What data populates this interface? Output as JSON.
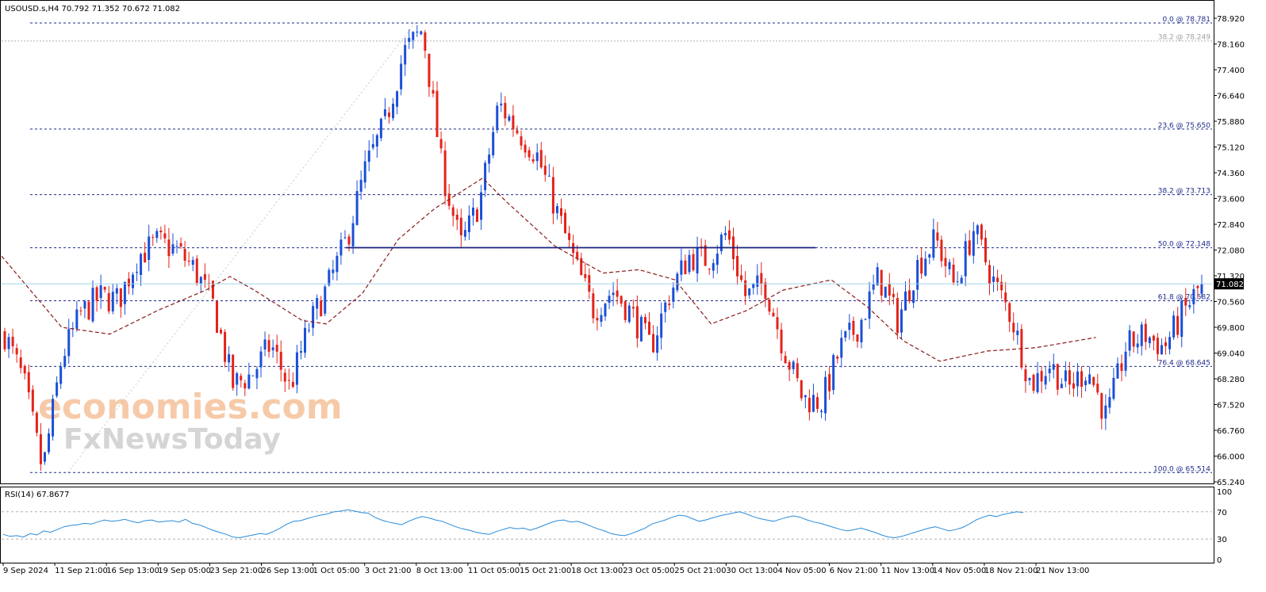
{
  "header": {
    "symbol_info": "USOUSD.s,H4  70.792 71.352 70.672 71.082",
    "rsi_label": "RSI(14) 67.8677"
  },
  "watermark": {
    "line1": "economies.com",
    "line2": "FxNewsToday"
  },
  "colors": {
    "bull": "#1b4fd6",
    "bear": "#e2231a",
    "ma": "#8b1a1a",
    "fib": "#1e2a8a",
    "resistance": "#1a237e",
    "rsi": "#2a8bd8",
    "current_price_line": "#9fd3e6",
    "price_tag_bg": "#000000"
  },
  "chart_data": [
    {
      "type": "candlestick",
      "symbol": "USOUSD.s",
      "timeframe": "H4",
      "ylim": [
        65.24,
        78.92
      ],
      "y_ticks": [
        "78.920",
        "78.160",
        "77.400",
        "76.640",
        "75.880",
        "75.120",
        "74.360",
        "73.600",
        "72.840",
        "72.080",
        "71.320",
        "70.560",
        "69.800",
        "69.040",
        "68.280",
        "67.520",
        "66.760",
        "66.000",
        "65.240"
      ],
      "x_ticks": [
        "9 Sep 2024",
        "11 Sep 21:00",
        "16 Sep 13:00",
        "19 Sep 05:00",
        "23 Sep 21:00",
        "26 Sep 13:00",
        "1 Oct 05:00",
        "3 Oct 21:00",
        "8 Oct 13:00",
        "11 Oct 05:00",
        "15 Oct 21:00",
        "18 Oct 13:00",
        "23 Oct 05:00",
        "25 Oct 21:00",
        "30 Oct 13:00",
        "4 Nov 05:00",
        "6 Nov 21:00",
        "11 Nov 13:00",
        "14 Nov 05:00",
        "18 Nov 21:00",
        "21 Nov 13:00"
      ],
      "current_price": "71.082",
      "last_ohlc": {
        "open": 70.792,
        "high": 71.352,
        "low": 70.672,
        "close": 71.082
      },
      "fib_levels": [
        {
          "label": "0.0 @ 78.781",
          "value": 78.781,
          "style": "dashed"
        },
        {
          "label": "38.2 @ 78.249",
          "value": 78.249,
          "style": "dotted"
        },
        {
          "label": "23.6 @ 75.650",
          "value": 75.65,
          "style": "dashed"
        },
        {
          "label": "38.2 @ 73.713",
          "value": 73.713,
          "style": "dashed"
        },
        {
          "label": "50.0 @ 72.148",
          "value": 72.148,
          "style": "dashed"
        },
        {
          "label": "61.8 @ 70.582",
          "value": 70.582,
          "style": "dashed"
        },
        {
          "label": "76.4 @ 68.645",
          "value": 68.645,
          "style": "dashed"
        },
        {
          "label": "100.0 @ 65.514",
          "value": 65.514,
          "style": "dashed"
        }
      ],
      "resistance_line": {
        "value": 72.15,
        "from_label": "3 Oct 21:00",
        "to_label": "6 Nov 21:00"
      },
      "anchors": [
        [
          "9 Sep 2024",
          69.6
        ],
        [
          "10 Sep",
          68.2
        ],
        [
          "10 Sep",
          65.55
        ],
        [
          "11 Sep 21:00",
          68.9
        ],
        [
          "13 Sep",
          70.2
        ],
        [
          "16 Sep 13:00",
          70.7
        ],
        [
          "18 Sep",
          70.6
        ],
        [
          "19 Sep 05:00",
          71.9
        ],
        [
          "20 Sep",
          72.3
        ],
        [
          "23 Sep 21:00",
          72.1
        ],
        [
          "24 Sep",
          71.5
        ],
        [
          "25 Sep",
          70.4
        ],
        [
          "26 Sep 13:00",
          68.1
        ],
        [
          "27 Sep",
          68.4
        ],
        [
          "30 Sep",
          69.3
        ],
        [
          "1 Oct 05:00",
          68.0
        ],
        [
          "1 Oct",
          69.8
        ],
        [
          "2 Oct",
          71.0
        ],
        [
          "3 Oct 21:00",
          72.4
        ],
        [
          "4 Oct",
          74.5
        ],
        [
          "5 Oct",
          75.8
        ],
        [
          "7 Oct",
          77.9
        ],
        [
          "7 Oct",
          78.6
        ],
        [
          "8 Oct",
          74.5
        ],
        [
          "8 Oct 13:00",
          72.2
        ],
        [
          "9 Oct",
          73.5
        ],
        [
          "10 Oct",
          76.4
        ],
        [
          "11 Oct 05:00",
          75.6
        ],
        [
          "11 Oct",
          74.9
        ],
        [
          "14 Oct",
          73.3
        ],
        [
          "14 Oct",
          71.7
        ],
        [
          "15 Oct 21:00",
          70.3
        ],
        [
          "16 Oct",
          70.9
        ],
        [
          "17 Oct",
          70.2
        ],
        [
          "18 Oct 13:00",
          69.2
        ],
        [
          "21 Oct",
          70.8
        ],
        [
          "22 Oct",
          71.9
        ],
        [
          "23 Oct 05:00",
          71.8
        ],
        [
          "23 Oct",
          72.6
        ],
        [
          "24 Oct",
          70.7
        ],
        [
          "25 Oct",
          71.1
        ],
        [
          "25 Oct 21:00",
          69.2
        ],
        [
          "28 Oct",
          67.7
        ],
        [
          "29 Oct",
          67.6
        ],
        [
          "30 Oct 13:00",
          69.2
        ],
        [
          "31 Oct",
          69.9
        ],
        [
          "1 Nov",
          71.3
        ],
        [
          "1 Nov",
          70.0
        ],
        [
          "4 Nov 05:00",
          71.6
        ],
        [
          "5 Nov",
          72.4
        ],
        [
          "6 Nov 21:00",
          71.0
        ],
        [
          "6 Nov",
          72.7
        ],
        [
          "7 Nov",
          71.2
        ],
        [
          "8 Nov",
          70.1
        ],
        [
          "11 Nov 13:00",
          68.1
        ],
        [
          "12 Nov",
          68.7
        ],
        [
          "13 Nov",
          68.0
        ],
        [
          "14 Nov 05:00",
          68.6
        ],
        [
          "15 Nov",
          67.1
        ],
        [
          "18 Nov 21:00",
          69.2
        ],
        [
          "19 Nov",
          69.6
        ],
        [
          "20 Nov",
          69.2
        ],
        [
          "21 Nov 13:00",
          70.2
        ],
        [
          "22 Nov",
          71.08
        ]
      ],
      "moving_average": {
        "style": "dashed",
        "points": [
          [
            0.0,
            71.9
          ],
          [
            0.05,
            69.8
          ],
          [
            0.09,
            69.6
          ],
          [
            0.13,
            70.3
          ],
          [
            0.17,
            70.9
          ],
          [
            0.19,
            71.3
          ],
          [
            0.21,
            70.9
          ],
          [
            0.25,
            70.0
          ],
          [
            0.27,
            69.9
          ],
          [
            0.3,
            70.8
          ],
          [
            0.33,
            72.4
          ],
          [
            0.36,
            73.3
          ],
          [
            0.4,
            74.2
          ],
          [
            0.42,
            73.5
          ],
          [
            0.46,
            72.2
          ],
          [
            0.5,
            71.4
          ],
          [
            0.53,
            71.5
          ],
          [
            0.56,
            71.2
          ],
          [
            0.59,
            69.9
          ],
          [
            0.62,
            70.3
          ],
          [
            0.65,
            70.9
          ],
          [
            0.69,
            71.2
          ],
          [
            0.72,
            70.4
          ],
          [
            0.75,
            69.4
          ],
          [
            0.78,
            68.8
          ],
          [
            0.82,
            69.1
          ],
          [
            0.86,
            69.2
          ],
          [
            0.91,
            69.5
          ]
        ]
      },
      "fib_swing_line": {
        "from": [
          0.055,
          65.514
        ],
        "to": [
          0.344,
          78.781
        ],
        "style": "dotted"
      }
    },
    {
      "type": "line",
      "name": "RSI(14)",
      "current_value": 67.8677,
      "ylim": [
        0,
        100
      ],
      "y_ticks": [
        "100",
        "70",
        "30",
        "0"
      ],
      "levels": [
        70,
        30
      ],
      "values": [
        37,
        34,
        35,
        33,
        38,
        36,
        42,
        40,
        44,
        48,
        50,
        51,
        53,
        52,
        55,
        58,
        56,
        57,
        59,
        56,
        54,
        57,
        58,
        55,
        56,
        57,
        55,
        59,
        53,
        51,
        47,
        43,
        40,
        37,
        33,
        32,
        34,
        36,
        38,
        37,
        41,
        46,
        52,
        56,
        57,
        60,
        63,
        65,
        67,
        70,
        71,
        73,
        71,
        69,
        68,
        62,
        58,
        55,
        53,
        51,
        56,
        60,
        63,
        61,
        58,
        56,
        52,
        48,
        45,
        43,
        40,
        38,
        37,
        41,
        44,
        47,
        45,
        46,
        43,
        46,
        50,
        54,
        57,
        58,
        55,
        56,
        53,
        49,
        45,
        42,
        38,
        36,
        35,
        38,
        42,
        46,
        52,
        55,
        58,
        62,
        65,
        64,
        60,
        56,
        58,
        61,
        64,
        66,
        68,
        70,
        67,
        63,
        60,
        58,
        56,
        59,
        62,
        64,
        62,
        58,
        55,
        53,
        50,
        47,
        44,
        42,
        44,
        46,
        43,
        40,
        36,
        33,
        32,
        34,
        37,
        40,
        43,
        46,
        48,
        45,
        42,
        44,
        47,
        52,
        58,
        62,
        65,
        63,
        66,
        68,
        70,
        69
      ]
    }
  ]
}
